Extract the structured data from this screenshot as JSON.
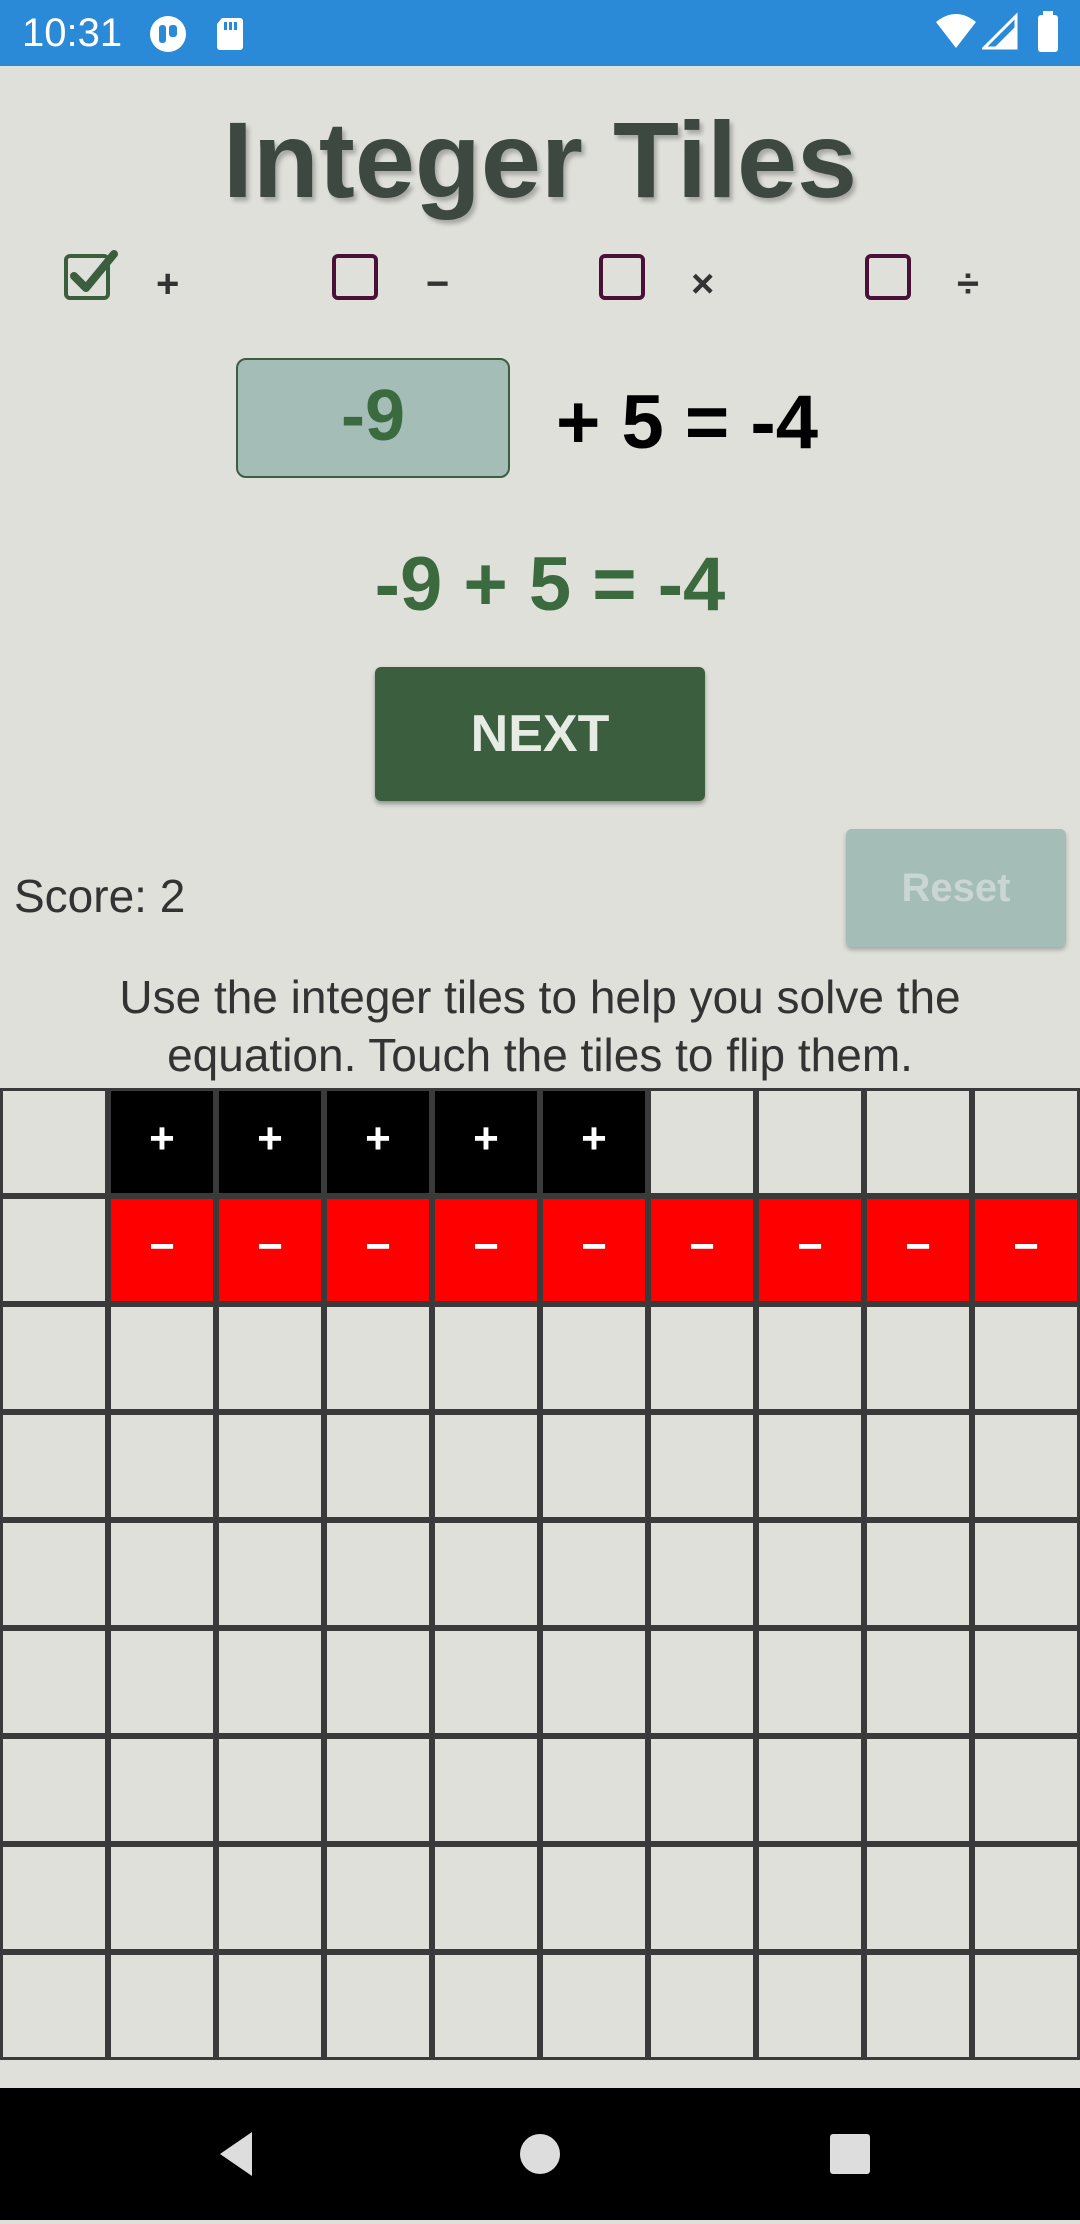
{
  "status_bar": {
    "time": "10:31",
    "icons": [
      "app-notification-icon",
      "sd-card-icon",
      "wifi-icon",
      "signal-icon",
      "battery-icon"
    ]
  },
  "title": "Integer Tiles",
  "operations": [
    {
      "label": "+",
      "checked": true
    },
    {
      "label": "−",
      "checked": false
    },
    {
      "label": "×",
      "checked": false
    },
    {
      "label": "÷",
      "checked": false
    }
  ],
  "equation": {
    "answer": "-9",
    "rest": "+ 5 = -4",
    "solution": "-9 + 5 = -4"
  },
  "next_label": "NEXT",
  "score_text": "Score: 2",
  "reset_label": "Reset",
  "instructions": "Use the integer tiles to help you solve the equation. Touch the tiles to flip them.",
  "grid": {
    "columns": 10,
    "visible_rows": 9,
    "rows": [
      [
        "",
        "+",
        "+",
        "+",
        "+",
        "+",
        "",
        "",
        "",
        ""
      ],
      [
        "",
        "−",
        "−",
        "−",
        "−",
        "−",
        "−",
        "−",
        "−",
        "−"
      ]
    ],
    "positive_symbol": "+",
    "negative_symbol": "−"
  },
  "nav_bar": {
    "buttons": [
      "back-icon",
      "home-icon",
      "recents-icon"
    ]
  },
  "colors": {
    "status_bar": "#2a8ad8",
    "background": "#dfe0da",
    "primary_green": "#3b5e3f",
    "answer_box": "#a4bdb6",
    "positive_tile": "#000000",
    "negative_tile": "#ff0000"
  }
}
